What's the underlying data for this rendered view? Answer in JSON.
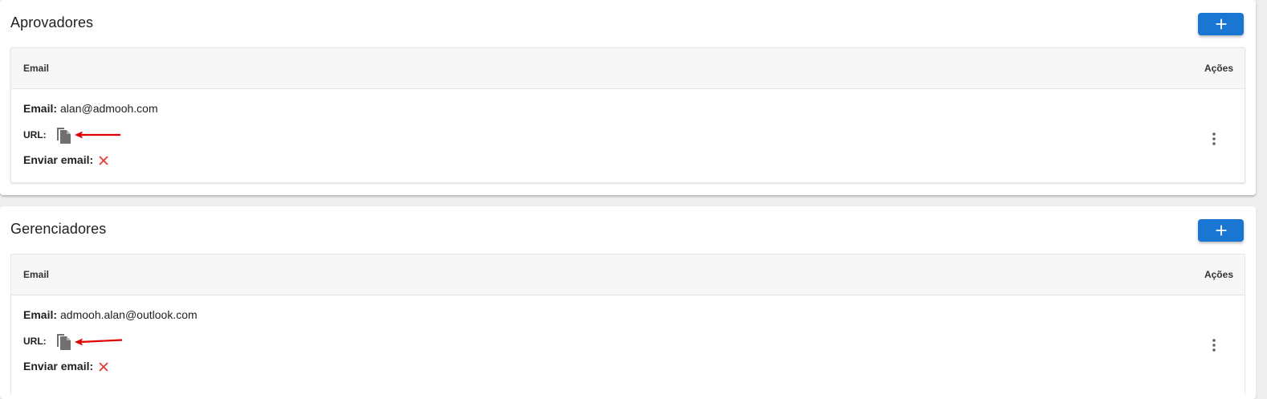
{
  "sections": [
    {
      "title": "Aprovadores",
      "add_button": "+",
      "columns": {
        "email": "Email",
        "actions": "Ações"
      },
      "rows": [
        {
          "email_label": "Email:",
          "email_value": "alan@admooh.com",
          "url_label": "URL:",
          "send_label": "Enviar email:"
        }
      ]
    },
    {
      "title": "Gerenciadores",
      "add_button": "+",
      "columns": {
        "email": "Email",
        "actions": "Ações"
      },
      "rows": [
        {
          "email_label": "Email:",
          "email_value": "admooh.alan@outlook.com",
          "url_label": "URL:",
          "send_label": "Enviar email:"
        }
      ]
    }
  ],
  "colors": {
    "primary": "#1976d2",
    "danger": "#e53935",
    "annotation_arrow": "#e10000",
    "icon_gray": "#616161"
  }
}
